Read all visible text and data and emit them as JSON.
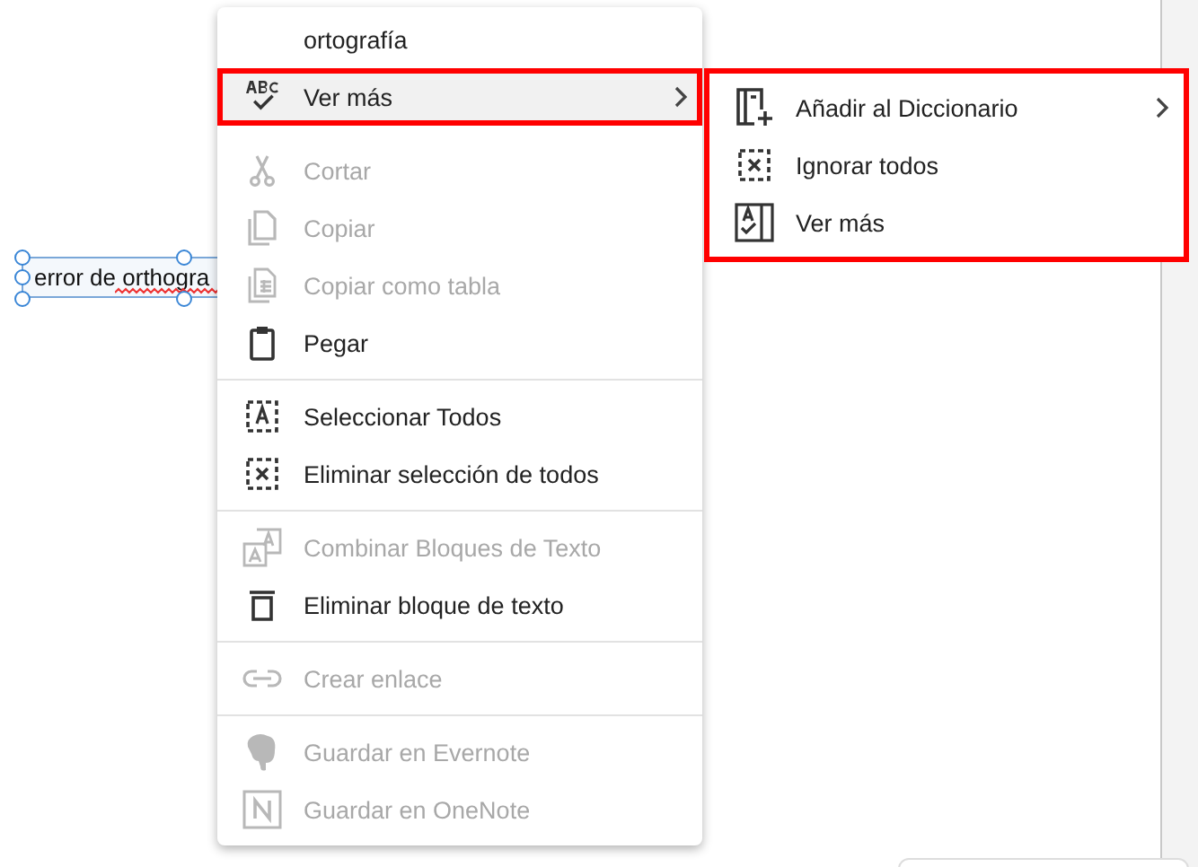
{
  "text_box": {
    "text": "error de orthogra",
    "misspelled_last_word": true
  },
  "context_menu": {
    "sections": [
      {
        "divider": false,
        "items": [
          {
            "label": "ortografía",
            "disabled": false,
            "selected": false,
            "outlined": false,
            "submenu": false
          },
          {
            "label": "Ver más",
            "disabled": false,
            "selected": true,
            "outlined": true,
            "submenu": true
          }
        ]
      },
      {
        "divider": false,
        "items": [
          {
            "label": "Cortar",
            "disabled": true,
            "selected": false,
            "outlined": false,
            "submenu": false
          },
          {
            "label": "Copiar",
            "disabled": true,
            "selected": false,
            "outlined": false,
            "submenu": false
          },
          {
            "label": "Copiar como tabla",
            "disabled": true,
            "selected": false,
            "outlined": false,
            "submenu": false
          },
          {
            "label": "Pegar",
            "disabled": false,
            "selected": false,
            "outlined": false,
            "submenu": false
          }
        ]
      },
      {
        "divider": true,
        "items": [
          {
            "label": "Seleccionar Todos",
            "disabled": false,
            "selected": false,
            "outlined": false,
            "submenu": false
          },
          {
            "label": "Eliminar selección de todos",
            "disabled": false,
            "selected": false,
            "outlined": false,
            "submenu": false
          }
        ]
      },
      {
        "divider": true,
        "items": [
          {
            "label": "Combinar Bloques de Texto",
            "disabled": true,
            "selected": false,
            "outlined": false,
            "submenu": false
          },
          {
            "label": "Eliminar bloque de texto",
            "disabled": false,
            "selected": false,
            "outlined": false,
            "submenu": false
          }
        ]
      },
      {
        "divider": true,
        "items": [
          {
            "label": "Crear enlace",
            "disabled": true,
            "selected": false,
            "outlined": false,
            "submenu": false
          }
        ]
      },
      {
        "divider": true,
        "items": [
          {
            "label": "Guardar en Evernote",
            "disabled": true,
            "selected": false,
            "outlined": false,
            "submenu": false
          },
          {
            "label": "Guardar en OneNote",
            "disabled": true,
            "selected": false,
            "outlined": false,
            "submenu": false
          }
        ]
      }
    ]
  },
  "submenu": {
    "outlined": true,
    "items": [
      {
        "label": "Añadir al Diccionario",
        "disabled": false,
        "selected": false,
        "submenu": true
      },
      {
        "label": "Ignorar todos",
        "disabled": false,
        "selected": false,
        "submenu": false
      },
      {
        "label": "Ver más",
        "disabled": false,
        "selected": false,
        "submenu": false
      }
    ]
  }
}
